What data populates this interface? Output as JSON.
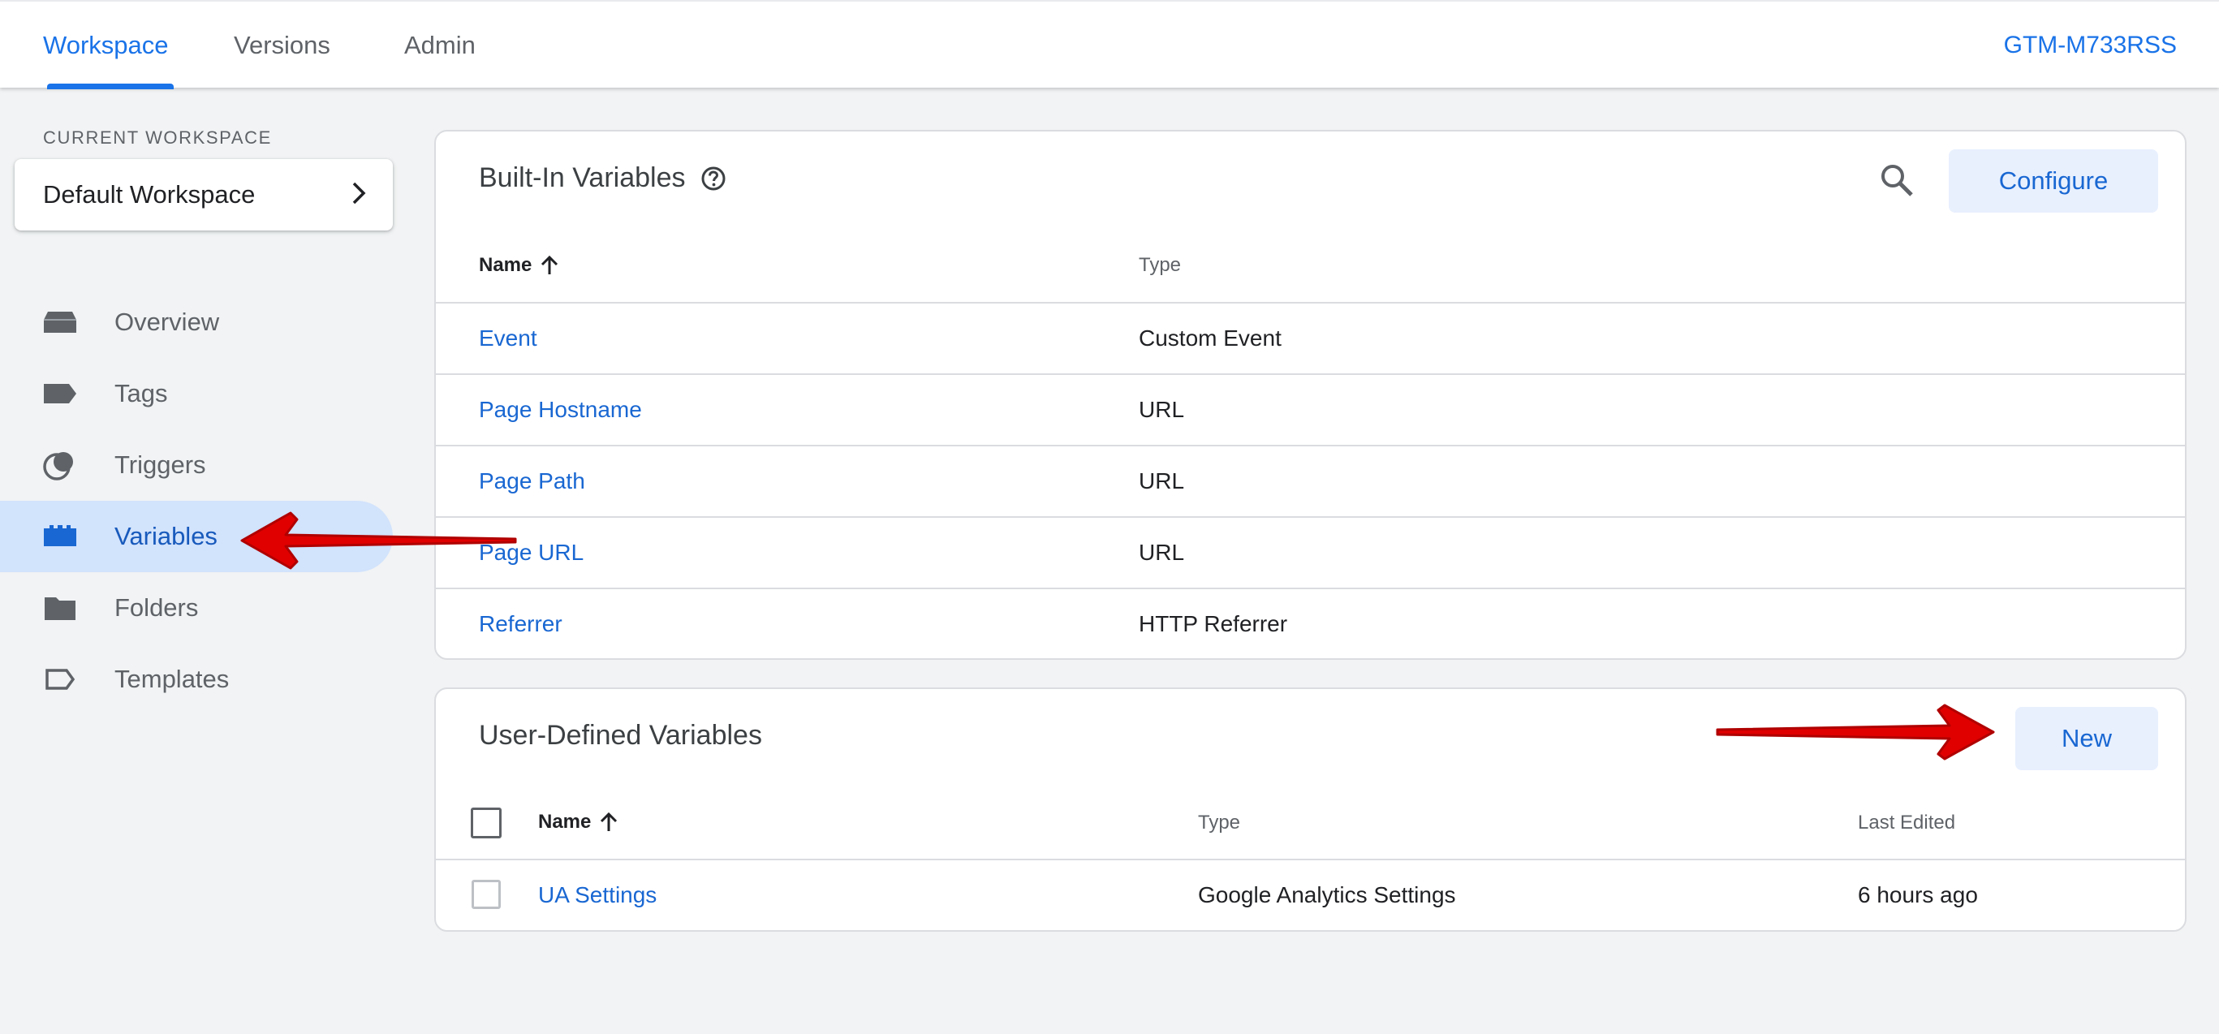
{
  "topnav": {
    "tabs": [
      {
        "label": "Workspace",
        "active": true
      },
      {
        "label": "Versions",
        "active": false
      },
      {
        "label": "Admin",
        "active": false
      }
    ],
    "container_id": "GTM-M733RSS"
  },
  "sidebar": {
    "workspace_label": "CURRENT WORKSPACE",
    "workspace_name": "Default Workspace",
    "items": [
      {
        "label": "Overview",
        "icon": "overview-icon",
        "active": false
      },
      {
        "label": "Tags",
        "icon": "tag-icon",
        "active": false
      },
      {
        "label": "Triggers",
        "icon": "trigger-icon",
        "active": false
      },
      {
        "label": "Variables",
        "icon": "variables-icon",
        "active": true
      },
      {
        "label": "Folders",
        "icon": "folder-icon",
        "active": false
      },
      {
        "label": "Templates",
        "icon": "template-icon",
        "active": false
      }
    ]
  },
  "builtin": {
    "title": "Built-In Variables",
    "configure_label": "Configure",
    "columns": {
      "name": "Name",
      "type": "Type"
    },
    "rows": [
      {
        "name": "Event",
        "type": "Custom Event"
      },
      {
        "name": "Page Hostname",
        "type": "URL"
      },
      {
        "name": "Page Path",
        "type": "URL"
      },
      {
        "name": "Page URL",
        "type": "URL"
      },
      {
        "name": "Referrer",
        "type": "HTTP Referrer"
      }
    ]
  },
  "userdefined": {
    "title": "User-Defined Variables",
    "new_label": "New",
    "columns": {
      "name": "Name",
      "type": "Type",
      "last_edited": "Last Edited"
    },
    "rows": [
      {
        "name": "UA Settings",
        "type": "Google Analytics Settings",
        "last_edited": "6 hours ago"
      }
    ]
  },
  "colors": {
    "accent": "#1a73e8",
    "link": "#1967d2",
    "active_nav_bg": "#d2e3fc",
    "annotation_arrow": "#e00000"
  }
}
